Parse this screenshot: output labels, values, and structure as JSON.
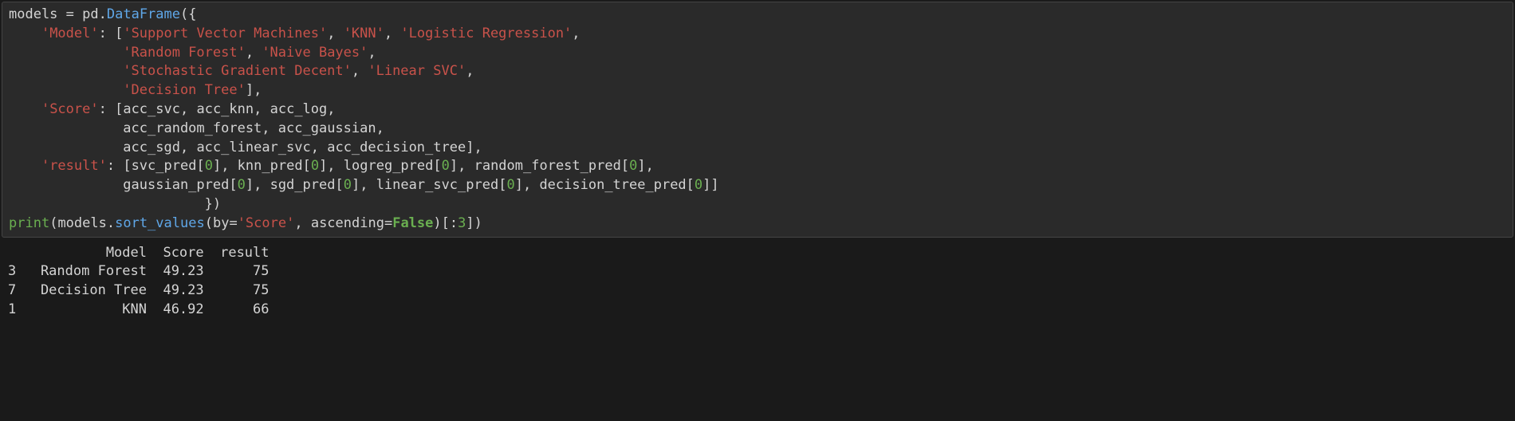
{
  "code": {
    "l1": {
      "models": "models",
      "eq": " = ",
      "pd": "pd",
      "dot": ".",
      "dataframe": "DataFrame",
      "open": "({"
    },
    "l2": {
      "pad": "    ",
      "key": "'Model'",
      "colon": ": [",
      "s1": "'Support Vector Machines'",
      "c1": ", ",
      "s2": "'KNN'",
      "c2": ", ",
      "s3": "'Logistic Regression'",
      "c3": ","
    },
    "l3": {
      "pad": "              ",
      "s1": "'Random Forest'",
      "c1": ", ",
      "s2": "'Naive Bayes'",
      "c2": ","
    },
    "l4": {
      "pad": "              ",
      "s1": "'Stochastic Gradient Decent'",
      "c1": ", ",
      "s2": "'Linear SVC'",
      "c2": ","
    },
    "l5": {
      "pad": "              ",
      "s1": "'Decision Tree'",
      "close": "],"
    },
    "l6": {
      "pad": "    ",
      "key": "'Score'",
      "colon": ": [",
      "v1": "acc_svc",
      "c1": ", ",
      "v2": "acc_knn",
      "c2": ", ",
      "v3": "acc_log",
      "c3": ","
    },
    "l7": {
      "pad": "              ",
      "v1": "acc_random_forest",
      "c1": ", ",
      "v2": "acc_gaussian",
      "c2": ","
    },
    "l8": {
      "pad": "              ",
      "v1": "acc_sgd",
      "c1": ", ",
      "v2": "acc_linear_svc",
      "c2": ", ",
      "v3": "acc_decision_tree",
      "close": "],"
    },
    "l9": {
      "pad": "    ",
      "key": "'result'",
      "colon": ": [",
      "v1": "svc_pred",
      "b1": "[",
      "n1": "0",
      "e1": "], ",
      "v2": "knn_pred",
      "b2": "[",
      "n2": "0",
      "e2": "], ",
      "v3": "logreg_pred",
      "b3": "[",
      "n3": "0",
      "e3": "], ",
      "v4": "random_forest_pred",
      "b4": "[",
      "n4": "0",
      "e4": "],"
    },
    "l10": {
      "pad": "              ",
      "v1": "gaussian_pred",
      "b1": "[",
      "n1": "0",
      "e1": "], ",
      "v2": "sgd_pred",
      "b2": "[",
      "n2": "0",
      "e2": "], ",
      "v3": "linear_svc_pred",
      "b3": "[",
      "n3": "0",
      "e3": "], ",
      "v4": "decision_tree_pred",
      "b4": "[",
      "n4": "0",
      "e4": "]]"
    },
    "l11": {
      "pad": "                        ",
      "close": "})"
    },
    "l12": {
      "print": "print",
      "open": "(",
      "models": "models",
      "dot": ".",
      "sort": "sort_values",
      "popen": "(",
      "by": "by",
      "eq": "=",
      "score": "'Score'",
      "comma": ", ",
      "asc": "ascending",
      "eq2": "=",
      "false": "False",
      "pclose": ")",
      "slice1": "[:",
      "three": "3",
      "slice2": "]",
      "close": ")"
    }
  },
  "output": {
    "header": "            Model  Score  result",
    "row1": "3   Random Forest  49.23      75",
    "row2": "7   Decision Tree  49.23      75",
    "row3": "1             KNN  46.92      66"
  },
  "chart_data": {
    "type": "table",
    "columns": [
      "",
      "Model",
      "Score",
      "result"
    ],
    "rows": [
      {
        "index": 3,
        "Model": "Random Forest",
        "Score": 49.23,
        "result": 75
      },
      {
        "index": 7,
        "Model": "Decision Tree",
        "Score": 49.23,
        "result": 75
      },
      {
        "index": 1,
        "Model": "KNN",
        "Score": 46.92,
        "result": 66
      }
    ]
  }
}
